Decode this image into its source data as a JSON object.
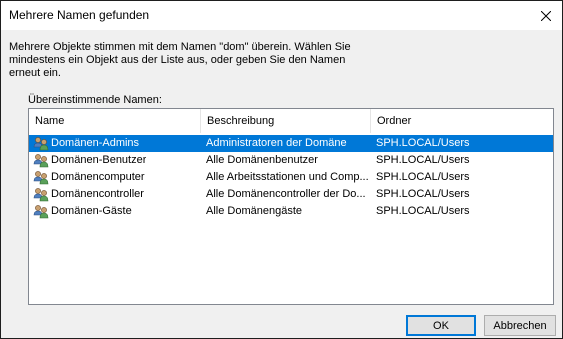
{
  "window": {
    "title": "Mehrere Namen gefunden"
  },
  "message": "Mehrere Objekte stimmen mit dem Namen \"dom\" überein. Wählen Sie mindestens ein Objekt aus der Liste aus, oder geben Sie den Namen erneut ein.",
  "list": {
    "label": "Übereinstimmende Namen:",
    "columns": {
      "name": "Name",
      "description": "Beschreibung",
      "folder": "Ordner"
    },
    "rows": [
      {
        "name": "Domänen-Admins",
        "description": "Administratoren der Domäne",
        "folder": "SPH.LOCAL/Users",
        "icon": "group-icon",
        "selected": true
      },
      {
        "name": "Domänen-Benutzer",
        "description": "Alle Domänenbenutzer",
        "folder": "SPH.LOCAL/Users",
        "icon": "group-icon",
        "selected": false
      },
      {
        "name": "Domänencomputer",
        "description": "Alle Arbeitsstationen und Comp...",
        "folder": "SPH.LOCAL/Users",
        "icon": "group-icon",
        "selected": false
      },
      {
        "name": "Domänencontroller",
        "description": "Alle Domänencontroller der Do...",
        "folder": "SPH.LOCAL/Users",
        "icon": "group-icon",
        "selected": false
      },
      {
        "name": "Domänen-Gäste",
        "description": "Alle Domänengäste",
        "folder": "SPH.LOCAL/Users",
        "icon": "group-icon",
        "selected": false
      }
    ]
  },
  "buttons": {
    "ok": "OK",
    "cancel": "Abbrechen"
  },
  "colors": {
    "selection": "#0078d7",
    "default_button_border": "#0078d7"
  }
}
